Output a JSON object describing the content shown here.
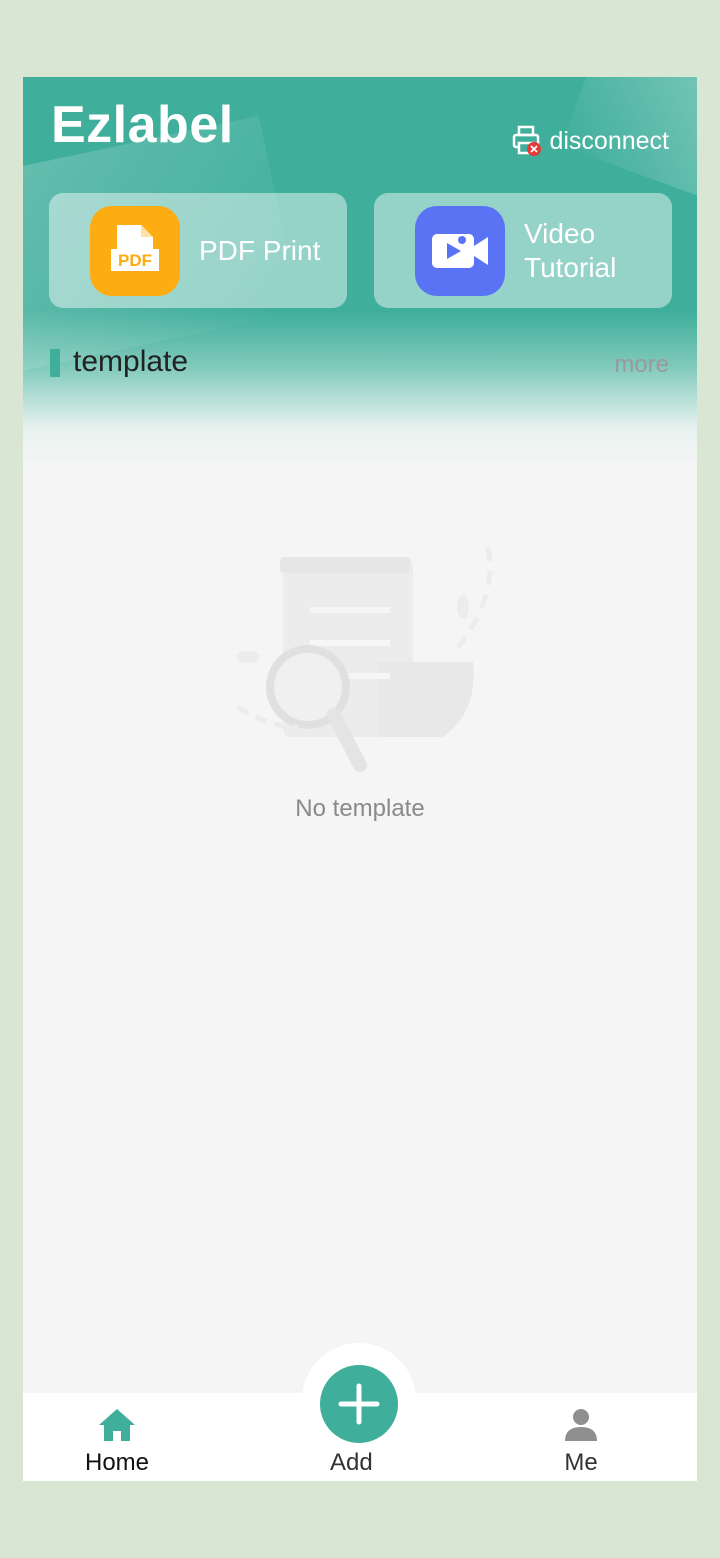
{
  "app": {
    "title": "Ezlabel"
  },
  "printer": {
    "status_text": "disconnect",
    "icon": "printer-disconnected-icon"
  },
  "quick_actions": [
    {
      "label": "PDF Print",
      "icon": "pdf-icon",
      "color": "#fdac11"
    },
    {
      "label_line1": "Video",
      "label_line2": "Tutorial",
      "icon": "video-icon",
      "color": "#5a73f4"
    }
  ],
  "section": {
    "title": "template",
    "more_label": "more"
  },
  "empty_state": {
    "message": "No template",
    "icon": "empty-search-document-icon"
  },
  "tabbar": {
    "home_label": "Home",
    "add_label": "Add",
    "me_label": "Me"
  },
  "colors": {
    "accent": "#3fae9b",
    "background": "#f5f5f5"
  }
}
